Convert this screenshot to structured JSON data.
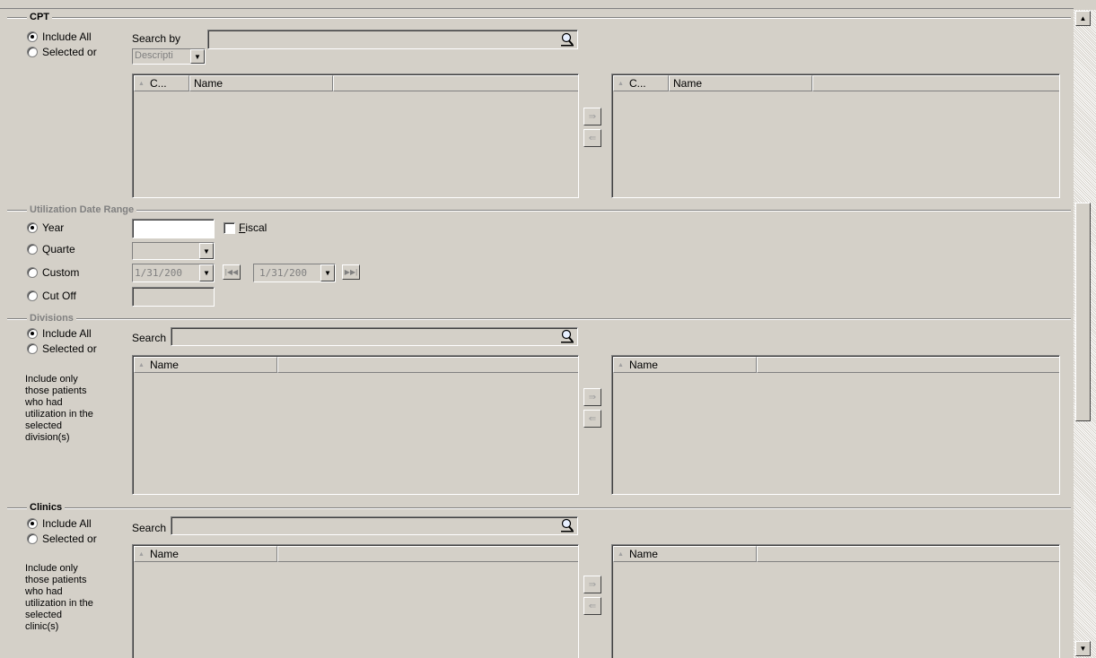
{
  "cpt": {
    "title": "CPT",
    "include_all": "Include All",
    "selected_only": "Selected or",
    "search_by_label": "Search by",
    "search_by_value": "",
    "search_type": "Descripti",
    "left_grid": {
      "col1": "C...",
      "col2": "Name"
    },
    "right_grid": {
      "col1": "C...",
      "col2": "Name"
    }
  },
  "util": {
    "title": "Utilization Date Range",
    "year_label": "Year",
    "quarter_label": "Quarte",
    "custom_label": "Custom",
    "cutoff_label": "Cut Off",
    "fiscal_label": "Fiscal",
    "fiscal_accel": "F",
    "year_value": "",
    "quarter_value": "",
    "custom_start": "1/31/200",
    "custom_end": "1/31/200",
    "cutoff_value": ""
  },
  "divisions": {
    "title": "Divisions",
    "include_all": "Include All",
    "selected_only": "Selected or",
    "search_label": "Search",
    "description": "Include only those patients who had utilization in the selected division(s)",
    "left_col": "Name",
    "right_col": "Name"
  },
  "clinics": {
    "title": "Clinics",
    "include_all": "Include All",
    "selected_only": "Selected or",
    "search_label": "Search",
    "description": "Include only those patients who had utilization in the selected clinic(s)",
    "left_col": "Name",
    "right_col": "Name"
  },
  "icons": {
    "search": "magnifier-icon",
    "add": "arrow-right-icon",
    "remove": "arrow-left-icon",
    "first": "first-icon",
    "last": "last-icon",
    "scroll_up": "up-arrow-icon",
    "scroll_down": "down-arrow-icon"
  },
  "colors": {
    "face": "#d4d0c8",
    "shadow": "#808080",
    "highlight": "#ffffff",
    "disabled_text": "#808080"
  }
}
